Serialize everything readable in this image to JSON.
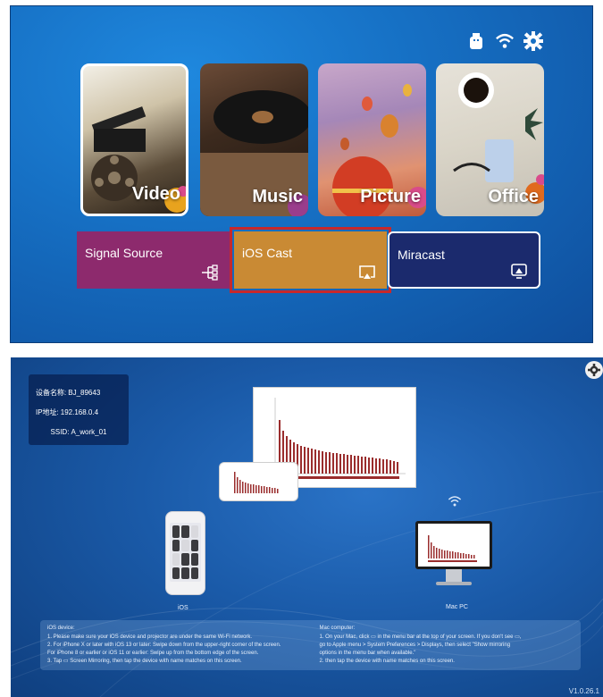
{
  "home": {
    "tiles": [
      {
        "label": "Video"
      },
      {
        "label": "Music"
      },
      {
        "label": "Picture"
      },
      {
        "label": "Office"
      }
    ],
    "sources": [
      {
        "label": "Signal Source",
        "icon": "signal-source-icon"
      },
      {
        "label": "iOS Cast",
        "icon": "screen-mirror-icon"
      },
      {
        "label": "Miracast",
        "icon": "cast-icon"
      }
    ],
    "status_icons": [
      "usb-icon",
      "wifi-icon",
      "gear-icon"
    ],
    "highlight_color": "#c8282b"
  },
  "cast_screen": {
    "info": {
      "device_name_label": "设备名称:",
      "device_name_value": "BJ_89643",
      "ip_label": "IP地址:",
      "ip_value": "192.168.0.4",
      "ssid_label": "SSID:",
      "ssid_value": "A_work_01"
    },
    "ios_label": "iOS",
    "mac_label": "Mac PC",
    "ios_instructions": {
      "title": "iOS device:",
      "steps": [
        "1. Please make sure your iOS device and projector are under the same Wi-Fi network.",
        "2. For iPhone X or later with iOS 13 or later: Swipe down from the upper-right corner of the screen.",
        "For iPhone 8 or earlier or iOS 11 or earlier: Swipe up from the bottom edge of the screen.",
        "3. Tap ▭ Screen Mirroring, then tap the device with name matches on this screen."
      ]
    },
    "mac_instructions": {
      "title": "Mac computer:",
      "steps": [
        "1. On your Mac, click ▭ in the menu bar at the top of your screen. If you don't see ▭,",
        "go to Apple menu > System Preferences > Displays, then select \"Show mirroring",
        "options in the menu bar when available.\"",
        "2. then tap the device with name matches on this screen."
      ]
    },
    "version": "V1.0.26.1"
  }
}
